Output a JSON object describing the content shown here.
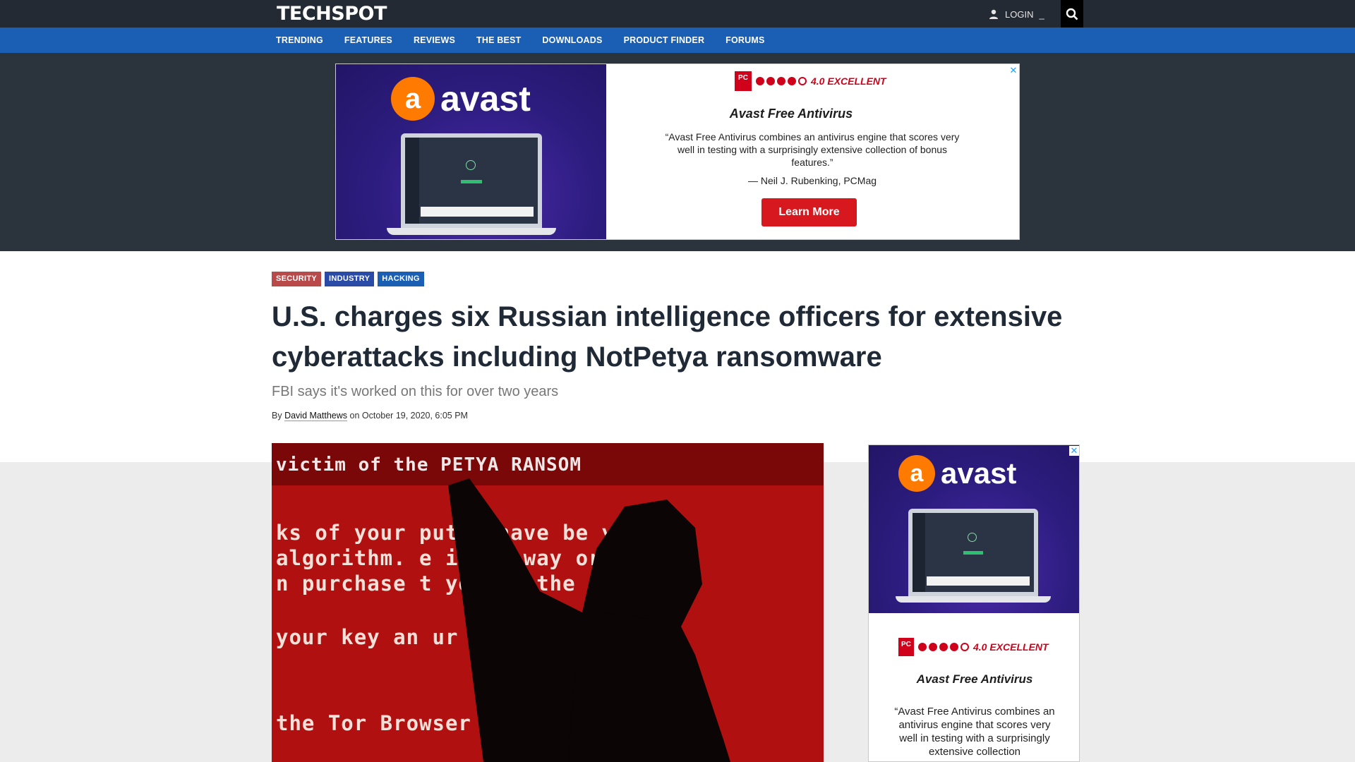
{
  "header": {
    "logo": "TECHSPOT",
    "login_label": "LOGIN",
    "login_icon": "user-icon",
    "search_icon": "search-icon"
  },
  "nav": {
    "items": [
      "TRENDING",
      "FEATURES",
      "REVIEWS",
      "THE BEST",
      "DOWNLOADS",
      "PRODUCT FINDER",
      "FORUMS"
    ]
  },
  "banner_ad": {
    "brand": "avast",
    "brand_mark": "a",
    "rating_logo": "PC",
    "rating_text": "4.0 EXCELLENT",
    "rating_value": 4,
    "rating_max": 5,
    "product": "Avast Free Antivirus",
    "quote": "“Avast Free Antivirus combines an antivirus engine that scores very well in testing with a surprisingly extensive collection of bonus features.”",
    "attribution": "— Neil J. Rubenking, PCMag",
    "cta": "Learn More",
    "close": "✕"
  },
  "article": {
    "tags": [
      "SECURITY",
      "INDUSTRY",
      "HACKING"
    ],
    "headline": "U.S. charges six Russian intelligence officers for extensive cyberattacks including NotPetya ransomware",
    "subheadline": "FBI says it's worked on this for over two years",
    "by": "By",
    "author": "David Matthews",
    "date": "on October 19, 2020, 6:05 PM",
    "hero_lines": [
      "victim of the PETYA RANSOM",
      "ks of your  puter have be  ypted",
      "algorithm.   e is no way   ore y",
      "n purchase t  you on the  page",
      "your key an   ur da",
      "the Tor Browser   \"htt"
    ]
  },
  "side_ad": {
    "brand": "avast",
    "rating_text": "4.0 EXCELLENT",
    "product": "Avast Free Antivirus",
    "quote": "“Avast Free Antivirus combines an antivirus engine that scores very well in testing with a surprisingly extensive collection",
    "close": "✕"
  },
  "colors": {
    "topbar": "#232a33",
    "navbar": "#1a5fb4",
    "accent_red": "#d7191f",
    "avast_orange": "#ff7a00"
  }
}
